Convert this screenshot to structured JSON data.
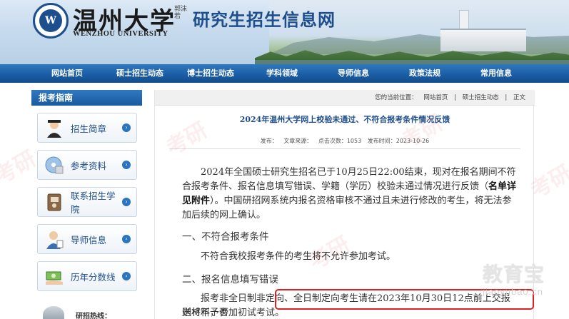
{
  "header": {
    "university_cn": "温州大学",
    "university_en": "WENZHOU UNIVERSITY",
    "seal_char": "W",
    "sign_text": "郭沫若",
    "site_title": "研究生招生信息网"
  },
  "nav": {
    "items": [
      {
        "label": "网站首页"
      },
      {
        "label": "硕士招生动态"
      },
      {
        "label": "博士招生动态"
      },
      {
        "label": "学科领域"
      },
      {
        "label": "导师信息"
      },
      {
        "label": "政策法规"
      },
      {
        "label": "常用信息"
      }
    ]
  },
  "sidebar": {
    "heading": "报考指南",
    "items": [
      {
        "label": "招生简章"
      },
      {
        "label": "参考资料"
      },
      {
        "label": "联系招生学院"
      },
      {
        "label": "导师信息"
      },
      {
        "label": "历年分数线"
      }
    ],
    "hotline": "研招热线："
  },
  "breadcrumb": {
    "prefix": "您的当前位置：",
    "items": [
      "网站首页",
      "硕士招生动态",
      "正文"
    ],
    "separator": "|"
  },
  "article": {
    "title": "2024年温州大学网上校验未通过、不符合报考条件情况反馈",
    "meta": {
      "publisher": "发布：",
      "source": "文章来源：",
      "clicks": "点击次数：1053",
      "date": "发布时间：2023-10-26"
    },
    "paragraph1_a": "2024年全国硕士研究生招名已于10月25日22:00结束，现对在报名期间不符合报考条件、报名信息填写错误、学籍（学历）校验未通过情况进行反馈（",
    "paragraph1_bold": "名单详见附件",
    "paragraph1_b": "）。中国研招网系统内报名资格审核不通过且未进行修改的考生，将无法参加后续的网上确认。",
    "section1_head": "一、不符合报考条件",
    "section1_body": "不符合我校报考条件的考生将不允许参加考试。",
    "section2_head": "二、报名信息填写错误",
    "section2_body_a": "报考非全日制非定向、",
    "section2_body_b": "全日制定向考生请在2023年10月30日12点前上交报送材料，否",
    "section2_body_c": "则将不予参加初试考试。"
  },
  "watermark": {
    "text": "考研",
    "corner_cn": "教育宝",
    "corner_en": "jiaoyubao.cn"
  },
  "colors": {
    "nav_blue": "#1b5ea6",
    "title_blue": "#1f4e8c",
    "highlight_red": "#e02020"
  }
}
